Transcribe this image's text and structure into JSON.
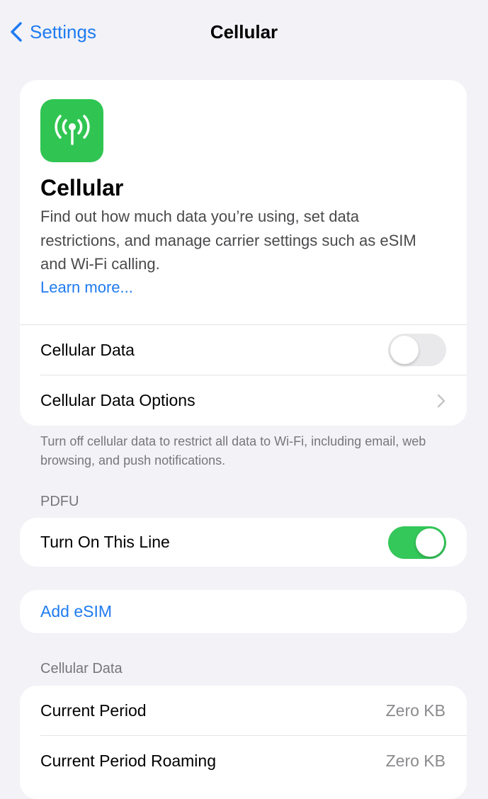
{
  "nav": {
    "back_label": "Settings",
    "title": "Cellular"
  },
  "hero": {
    "icon": "antenna-radiowaves-icon",
    "title": "Cellular",
    "description": "Find out how much data you’re using, set data restrictions, and manage carrier settings such as eSIM and Wi-Fi calling.",
    "learn_more": "Learn more..."
  },
  "main_group": {
    "cellular_data_label": "Cellular Data",
    "cellular_data_on": false,
    "options_label": "Cellular Data Options"
  },
  "footnote": "Turn off cellular data to restrict all data to Wi-Fi, including email, web browsing, and push notifications.",
  "line_section": {
    "header": "PDFU",
    "turn_on_label": "Turn On This Line",
    "turn_on_enabled": true
  },
  "esim": {
    "add_label": "Add eSIM"
  },
  "usage_section": {
    "header": "Cellular Data",
    "rows": [
      {
        "label": "Current Period",
        "value": "Zero KB"
      },
      {
        "label": "Current Period Roaming",
        "value": "Zero KB"
      }
    ]
  },
  "colors": {
    "accent": "#1f7bf0",
    "toggle_on": "#34c759",
    "icon_bg": "#30c552",
    "background": "#f2f2f7"
  }
}
